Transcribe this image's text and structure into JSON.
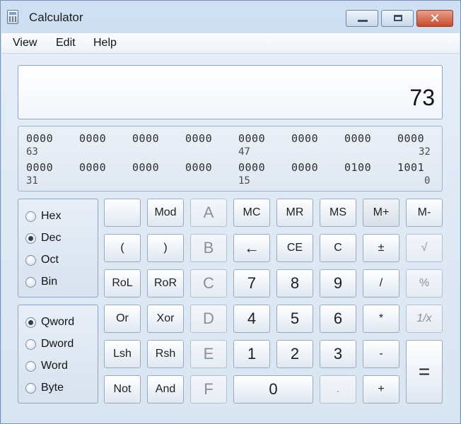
{
  "window": {
    "title": "Calculator"
  },
  "menu": [
    "View",
    "Edit",
    "Help"
  ],
  "display": {
    "value": "73"
  },
  "bits": {
    "row1": [
      "0000",
      "0000",
      "0000",
      "0000",
      "0000",
      "0000",
      "0000",
      "0000"
    ],
    "row1_positions": [
      "63",
      "47",
      "32"
    ],
    "row2": [
      "0000",
      "0000",
      "0000",
      "0000",
      "0000",
      "0000",
      "0100",
      "1001"
    ],
    "row2_positions": [
      "31",
      "15",
      "0"
    ]
  },
  "radix": {
    "options": [
      "Hex",
      "Dec",
      "Oct",
      "Bin"
    ],
    "selected": "Dec"
  },
  "word_size": {
    "options": [
      "Qword",
      "Dword",
      "Word",
      "Byte"
    ],
    "selected": "Qword"
  },
  "keys": {
    "row1": [
      "",
      "Mod",
      "A",
      "MC",
      "MR",
      "MS",
      "M+",
      "M-"
    ],
    "row2": [
      "(",
      ")",
      "B",
      "←",
      "CE",
      "C",
      "±",
      "√"
    ],
    "row3": [
      "RoL",
      "RoR",
      "C",
      "7",
      "8",
      "9",
      "/",
      "%"
    ],
    "row4": [
      "Or",
      "Xor",
      "D",
      "4",
      "5",
      "6",
      "*",
      "1/x"
    ],
    "row5": [
      "Lsh",
      "Rsh",
      "E",
      "1",
      "2",
      "3",
      "-",
      "="
    ],
    "row6": [
      "Not",
      "And",
      "F",
      "0",
      ".",
      "+"
    ]
  },
  "colors": {
    "titlebar": "#c4d8ef",
    "close_button": "#c84a2d",
    "display_bg": "#ffffff"
  }
}
